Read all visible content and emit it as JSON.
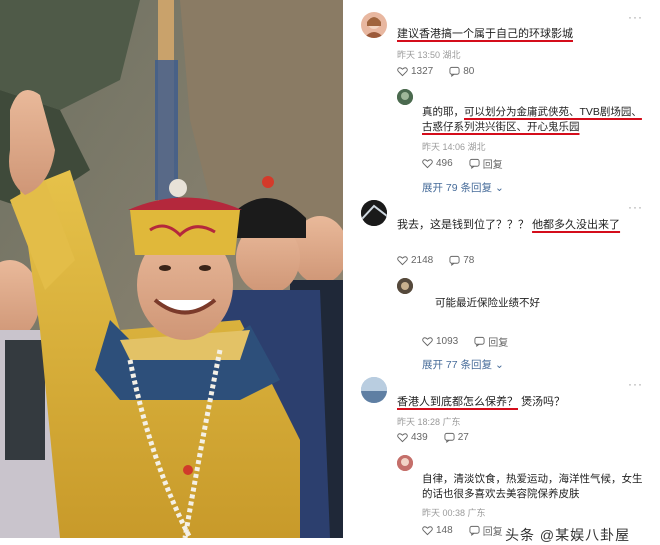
{
  "comments": [
    {
      "text": "建议香港搞一个属于自己的环球影城",
      "time": "昨天 13:50",
      "location": "湖北",
      "likes": "1327",
      "replies": "80"
    },
    {
      "text_a": "真的耶，",
      "text_b": "可以划分为金庸武侠苑、TVB剧场园、",
      "text_c": "古惑仔系列洪兴街区、开心鬼乐园",
      "text_d": "……",
      "time": "昨天 14:06",
      "location": "湖北",
      "likes": "496",
      "reply_label": "回复",
      "expand": "展开 79 条回复"
    },
    {
      "text_a": "我去，这是钱到位了？？？",
      "text_b": "他都多久没出来了",
      "likes": "2148",
      "replies": "78"
    },
    {
      "text": "可能最近保险业绩不好",
      "likes": "1093",
      "reply_label": "回复",
      "expand": "展开 77 条回复"
    },
    {
      "text_a": "香港人到底都怎么保养？",
      "text_b": "煲汤吗？",
      "time": "昨天 18:28",
      "location": "广东",
      "likes": "439",
      "replies": "27"
    },
    {
      "text_a": "自律，清淡饮食，热爱运动，海洋性气候，女生",
      "text_b": "的话也很多喜欢去美容院保养皮肤",
      "time": "昨天 00:38",
      "location": "广东",
      "likes": "148",
      "reply_label": "回复"
    }
  ],
  "more_icon": "···",
  "watermark": "头条 @某娱八卦屋"
}
